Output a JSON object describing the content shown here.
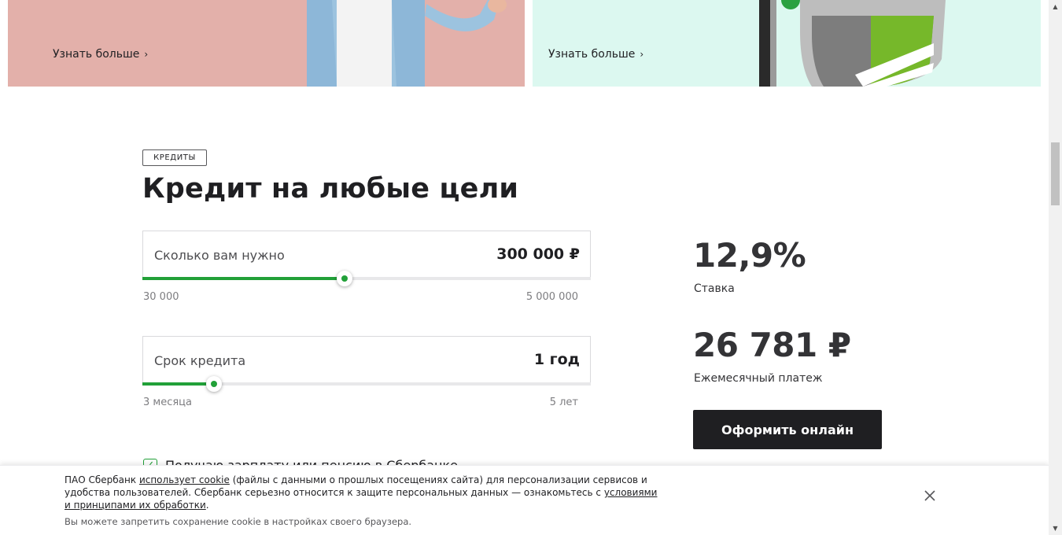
{
  "banners": [
    {
      "link_label": "Узнать больше",
      "chevron_icon": "chevron-right-icon"
    },
    {
      "link_label": "Узнать больше",
      "chevron_icon": "chevron-right-icon"
    }
  ],
  "product": {
    "tag": "КРЕДИТЫ",
    "title": "Кредит на любые цели"
  },
  "calculator": {
    "amount": {
      "label": "Сколько вам нужно",
      "value": "300 000 ₽",
      "min_label": "30 000",
      "max_label": "5 000 000",
      "slider_percent": 45
    },
    "term": {
      "label": "Срок кредита",
      "value": "1 год",
      "min_label": "3 месяца",
      "max_label": "5 лет",
      "slider_percent": 16
    },
    "checkbox_label": "Получаю зарплату или пенсию в Сбербанке",
    "checkbox_checked": true
  },
  "results": {
    "rate_value": "12,9%",
    "rate_caption": "Ставка",
    "payment_value": "26 781 ₽",
    "payment_caption": "Ежемесячный платеж",
    "cta_label": "Оформить онлайн"
  },
  "cookie": {
    "text_before": "ПАО Сбербанк ",
    "link_uses_cookie": "использует cookie",
    "text_middle": " (файлы с данными о прошлых посещениях сайта) для персонализации сервисов и удобства пользователей. Сбербанк серьезно относится к защите персональных данных — ознакомьтесь с ",
    "link_terms": "условиями и принципами их обработки",
    "text_after": ".",
    "note": "Вы можете запретить сохранение cookie в настройках своего браузера."
  },
  "colors": {
    "accent_green": "#21a038",
    "banner_left_bg": "#e3b0aa",
    "banner_right_bg": "#dcf8f0",
    "button_bg": "#1f1f22"
  }
}
